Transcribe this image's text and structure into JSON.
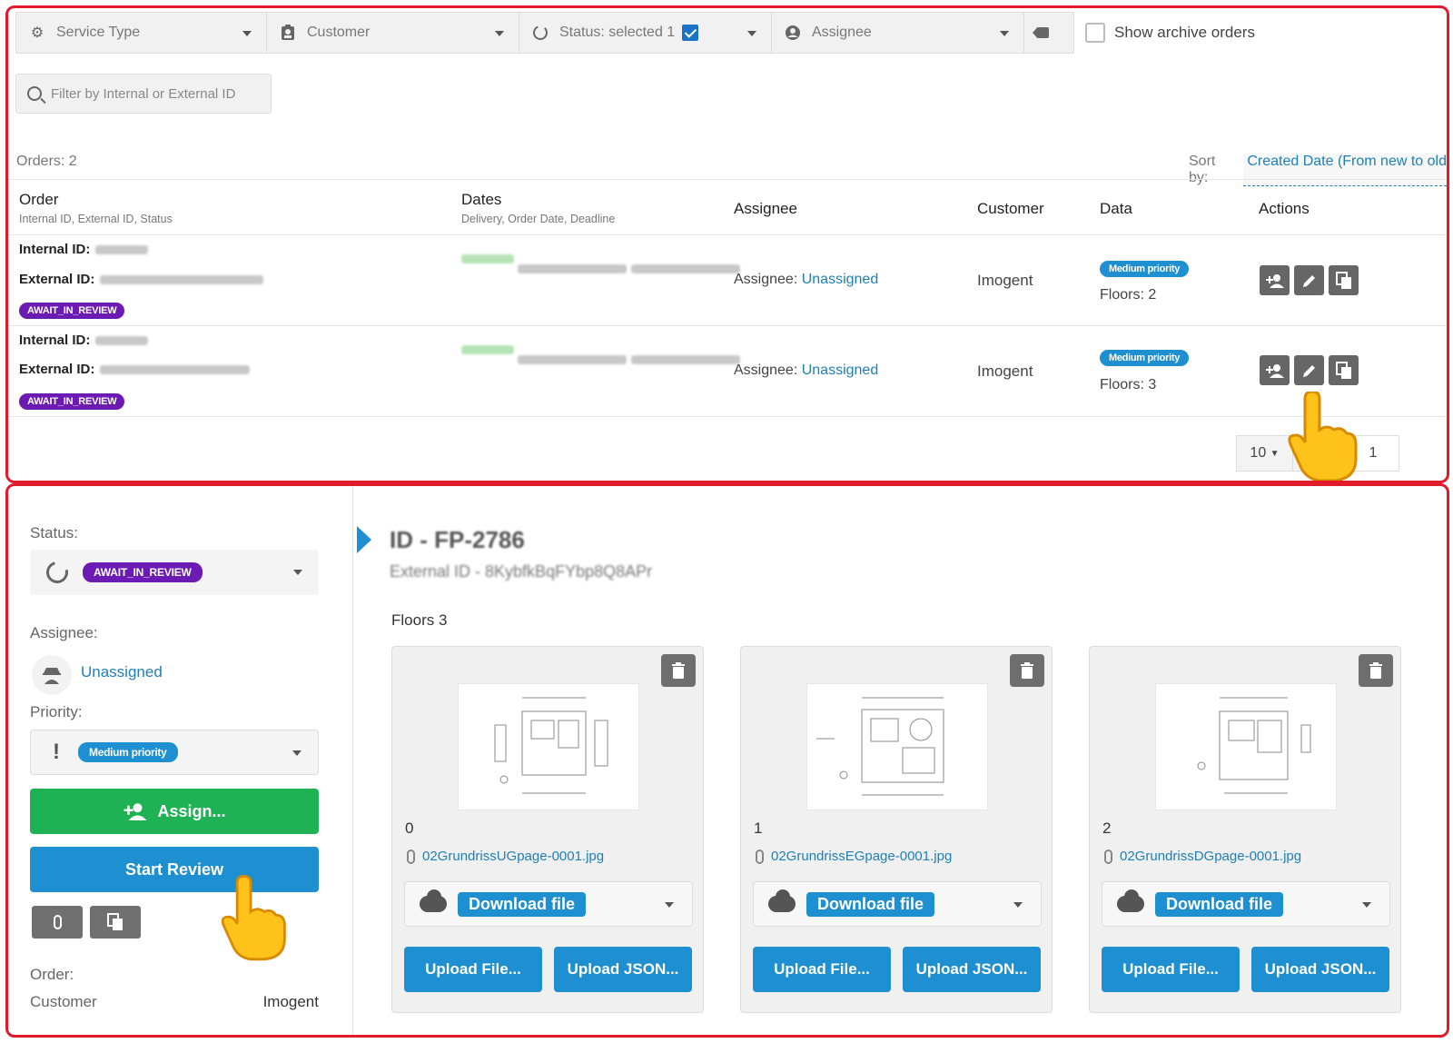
{
  "filters": {
    "service_type": "Service Type",
    "customer": "Customer",
    "status": "Status: selected 1",
    "assignee": "Assignee",
    "show_archive": "Show archive orders"
  },
  "search": {
    "placeholder": "Filter by Internal or External ID"
  },
  "orders_count": "Orders: 2",
  "sort": {
    "label": "Sort by:",
    "value": "Created Date (From new to old"
  },
  "table": {
    "headers": {
      "order": "Order",
      "order_sub": "Internal ID, External ID, Status",
      "dates": "Dates",
      "dates_sub": "Delivery, Order Date, Deadline",
      "assignee": "Assignee",
      "customer": "Customer",
      "data": "Data",
      "actions": "Actions"
    },
    "rows": [
      {
        "internal_label": "Internal ID:",
        "external_label": "External ID:",
        "status": "AWAIT_IN_REVIEW",
        "assignee_label": "Assignee:",
        "assignee_value": "Unassigned",
        "customer": "Imogent",
        "priority": "Medium priority",
        "floors": "Floors: 2"
      },
      {
        "internal_label": "Internal ID:",
        "external_label": "External ID:",
        "status": "AWAIT_IN_REVIEW",
        "assignee_label": "Assignee:",
        "assignee_value": "Unassigned",
        "customer": "Imogent",
        "priority": "Medium priority",
        "floors": "Floors: 3"
      }
    ]
  },
  "pagination": {
    "page_size": "10",
    "current_page": "1"
  },
  "detail": {
    "status_label": "Status:",
    "status_value": "AWAIT_IN_REVIEW",
    "assignee_label": "Assignee:",
    "assignee_value": "Unassigned",
    "priority_label": "Priority:",
    "priority_value": "Medium priority",
    "assign_button": "Assign...",
    "start_review_button": "Start Review",
    "order_label": "Order:",
    "customer_label": "Customer",
    "customer_value": "Imogent",
    "title": "ID - FP-2786",
    "subtitle": "External ID - 8KybfkBqFYbp8Q8APr",
    "floors_title": "Floors 3",
    "floors": [
      {
        "index": "0",
        "file": "02GrundrissUGpage-0001.jpg",
        "download": "Download file",
        "upload_file": "Upload File...",
        "upload_json": "Upload JSON..."
      },
      {
        "index": "1",
        "file": "02GrundrissEGpage-0001.jpg",
        "download": "Download file",
        "upload_file": "Upload File...",
        "upload_json": "Upload JSON..."
      },
      {
        "index": "2",
        "file": "02GrundrissDGpage-0001.jpg",
        "download": "Download file",
        "upload_file": "Upload File...",
        "upload_json": "Upload JSON..."
      }
    ]
  },
  "colors": {
    "highlight_border": "#e21b2c",
    "status_badge": "#6c1ab4",
    "priority_badge": "#1e8fd0",
    "link": "#1e7fb8",
    "assign_button": "#1fb254",
    "primary_button": "#1e8fd0"
  }
}
